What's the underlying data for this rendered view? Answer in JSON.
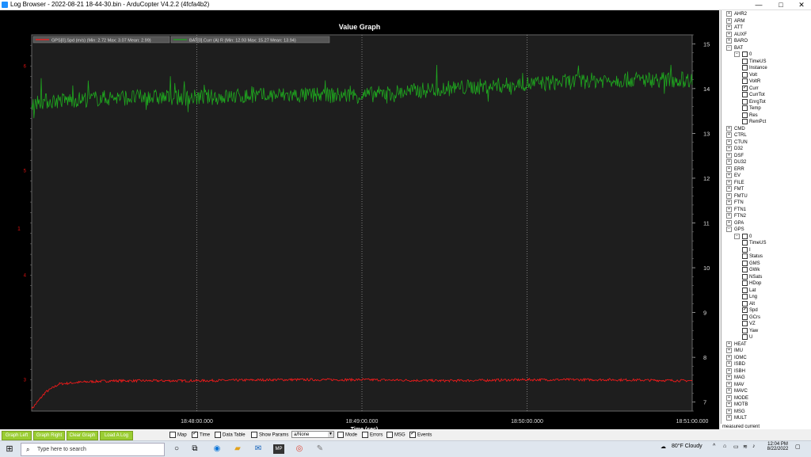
{
  "window": {
    "title": "Log Browser - 2022-08-21 18-44-30.bin - ArduCopter V4.2.2 (4fcfa4b2)",
    "controls": {
      "minimize": "—",
      "maximize": "□",
      "close": "✕"
    }
  },
  "graph": {
    "title": "Value Graph",
    "legend": [
      {
        "label": "GPS[0].Spd (m/s)  (Min: 2.72 Max: 3.07 Mean: 2.99)",
        "color": "#ff1a1a"
      },
      {
        "label": "BAT[0].Curr (A)  R (Min: 12.93 Max: 15.27 Mean: 13.94)",
        "color": "#1fa81f"
      }
    ],
    "xlabel": "Time (sec)",
    "x_ticks": [
      "18:48:00.000",
      "18:49:00.000",
      "18:50:00.000",
      "18:51:00.000"
    ],
    "left_axis_label": "1",
    "left_ticks": [
      "6",
      "5",
      "4",
      "3"
    ],
    "right_ticks": [
      "15",
      "14",
      "13",
      "12",
      "11",
      "10",
      "9",
      "8",
      "7"
    ]
  },
  "chart_data": {
    "type": "line",
    "title": "Value Graph",
    "xlabel": "Time (sec)",
    "x_range": [
      "18:47:00",
      "18:51:00"
    ],
    "series": [
      {
        "name": "GPS[0].Spd (m/s)",
        "axis": "left",
        "min": 2.72,
        "max": 3.07,
        "mean": 2.99,
        "x": [
          "18:47:00",
          "18:47:05",
          "18:47:10",
          "18:47:20",
          "18:47:30",
          "18:48:00",
          "18:48:30",
          "18:49:00",
          "18:49:30",
          "18:50:00",
          "18:50:30",
          "18:51:00"
        ],
        "values": [
          2.72,
          2.88,
          2.96,
          2.98,
          2.99,
          2.99,
          3.0,
          3.0,
          2.99,
          3.0,
          3.0,
          2.99
        ]
      },
      {
        "name": "BAT[0].Curr (A)",
        "axis": "right",
        "min": 12.93,
        "max": 15.27,
        "mean": 13.94,
        "x": [
          "18:47:00",
          "18:47:30",
          "18:48:00",
          "18:48:30",
          "18:49:00",
          "18:49:30",
          "18:50:00",
          "18:50:30",
          "18:51:00"
        ],
        "values": [
          13.7,
          13.8,
          13.8,
          13.85,
          13.85,
          14.0,
          14.1,
          14.2,
          14.2
        ]
      }
    ],
    "left_ylim": [
      2.7,
      6.3
    ],
    "right_ylim": [
      6.8,
      15.2
    ],
    "grid": true
  },
  "tree": {
    "items": [
      {
        "label": "AHR2",
        "level": 0,
        "type": "plus"
      },
      {
        "label": "ARM",
        "level": 0,
        "type": "plus"
      },
      {
        "label": "ATT",
        "level": 0,
        "type": "plus"
      },
      {
        "label": "AUXF",
        "level": 0,
        "type": "plus"
      },
      {
        "label": "BARO",
        "level": 0,
        "type": "plus"
      },
      {
        "label": "BAT",
        "level": 0,
        "type": "minus"
      },
      {
        "label": "0",
        "level": 1,
        "type": "minus"
      },
      {
        "label": "TimeUS",
        "level": 2,
        "type": "check",
        "checked": false
      },
      {
        "label": "Instance",
        "level": 2,
        "type": "check",
        "checked": false
      },
      {
        "label": "Volt",
        "level": 2,
        "type": "check",
        "checked": false
      },
      {
        "label": "VoltR",
        "level": 2,
        "type": "check",
        "checked": false
      },
      {
        "label": "Curr",
        "level": 2,
        "type": "check",
        "checked": true
      },
      {
        "label": "CurrTot",
        "level": 2,
        "type": "check",
        "checked": false
      },
      {
        "label": "EnrgTot",
        "level": 2,
        "type": "check",
        "checked": false
      },
      {
        "label": "Temp",
        "level": 2,
        "type": "check",
        "checked": false
      },
      {
        "label": "Res",
        "level": 2,
        "type": "check",
        "checked": false
      },
      {
        "label": "RemPct",
        "level": 2,
        "type": "check",
        "checked": false
      },
      {
        "label": "CMD",
        "level": 0,
        "type": "plus"
      },
      {
        "label": "CTRL",
        "level": 0,
        "type": "plus"
      },
      {
        "label": "CTUN",
        "level": 0,
        "type": "plus"
      },
      {
        "label": "D32",
        "level": 0,
        "type": "plus"
      },
      {
        "label": "DSF",
        "level": 0,
        "type": "plus"
      },
      {
        "label": "DU32",
        "level": 0,
        "type": "plus"
      },
      {
        "label": "ERR",
        "level": 0,
        "type": "plus"
      },
      {
        "label": "EV",
        "level": 0,
        "type": "plus"
      },
      {
        "label": "FILE",
        "level": 0,
        "type": "plus"
      },
      {
        "label": "FMT",
        "level": 0,
        "type": "plus"
      },
      {
        "label": "FMTU",
        "level": 0,
        "type": "plus"
      },
      {
        "label": "FTN",
        "level": 0,
        "type": "plus"
      },
      {
        "label": "FTN1",
        "level": 0,
        "type": "plus"
      },
      {
        "label": "FTN2",
        "level": 0,
        "type": "plus"
      },
      {
        "label": "GPA",
        "level": 0,
        "type": "plus"
      },
      {
        "label": "GPS",
        "level": 0,
        "type": "minus"
      },
      {
        "label": "0",
        "level": 1,
        "type": "minus"
      },
      {
        "label": "TimeUS",
        "level": 2,
        "type": "check",
        "checked": false
      },
      {
        "label": "I",
        "level": 2,
        "type": "check",
        "checked": false
      },
      {
        "label": "Status",
        "level": 2,
        "type": "check",
        "checked": false
      },
      {
        "label": "GMS",
        "level": 2,
        "type": "check",
        "checked": false
      },
      {
        "label": "GWk",
        "level": 2,
        "type": "check",
        "checked": false
      },
      {
        "label": "NSats",
        "level": 2,
        "type": "check",
        "checked": false
      },
      {
        "label": "HDop",
        "level": 2,
        "type": "check",
        "checked": false
      },
      {
        "label": "Lat",
        "level": 2,
        "type": "check",
        "checked": false
      },
      {
        "label": "Lng",
        "level": 2,
        "type": "check",
        "checked": false
      },
      {
        "label": "Alt",
        "level": 2,
        "type": "check",
        "checked": false
      },
      {
        "label": "Spd",
        "level": 2,
        "type": "check",
        "checked": true
      },
      {
        "label": "GCrs",
        "level": 2,
        "type": "check",
        "checked": false
      },
      {
        "label": "VZ",
        "level": 2,
        "type": "check",
        "checked": false
      },
      {
        "label": "Yaw",
        "level": 2,
        "type": "check",
        "checked": false
      },
      {
        "label": "U",
        "level": 2,
        "type": "check",
        "checked": false
      },
      {
        "label": "HEAT",
        "level": 0,
        "type": "plus"
      },
      {
        "label": "IMU",
        "level": 0,
        "type": "plus"
      },
      {
        "label": "IOMC",
        "level": 0,
        "type": "plus"
      },
      {
        "label": "ISBD",
        "level": 0,
        "type": "plus"
      },
      {
        "label": "ISBH",
        "level": 0,
        "type": "plus"
      },
      {
        "label": "MAG",
        "level": 0,
        "type": "plus"
      },
      {
        "label": "MAV",
        "level": 0,
        "type": "plus"
      },
      {
        "label": "MAVC",
        "level": 0,
        "type": "plus"
      },
      {
        "label": "MODE",
        "level": 0,
        "type": "plus"
      },
      {
        "label": "MOTB",
        "level": 0,
        "type": "plus"
      },
      {
        "label": "MSG",
        "level": 0,
        "type": "plus"
      },
      {
        "label": "MULT",
        "level": 0,
        "type": "plus"
      }
    ],
    "status": "measured current"
  },
  "bottombar": {
    "buttons": [
      "Graph Left",
      "Graph Right",
      "Clear Graph",
      "Load A Log"
    ],
    "options": [
      {
        "label": "Map",
        "checked": false
      },
      {
        "label": "Time",
        "checked": true
      },
      {
        "label": "Data Table",
        "checked": false
      },
      {
        "label": "Show Params",
        "checked": false
      }
    ],
    "select_value": "a/None",
    "options2": [
      {
        "label": "Mode",
        "checked": false
      },
      {
        "label": "Errors",
        "checked": false
      },
      {
        "label": "MSG",
        "checked": false
      },
      {
        "label": "Events",
        "checked": true
      }
    ]
  },
  "taskbar": {
    "search_placeholder": "Type here to search",
    "weather": "80°F  Cloudy",
    "time": "12:04 PM",
    "date": "8/22/2022"
  }
}
